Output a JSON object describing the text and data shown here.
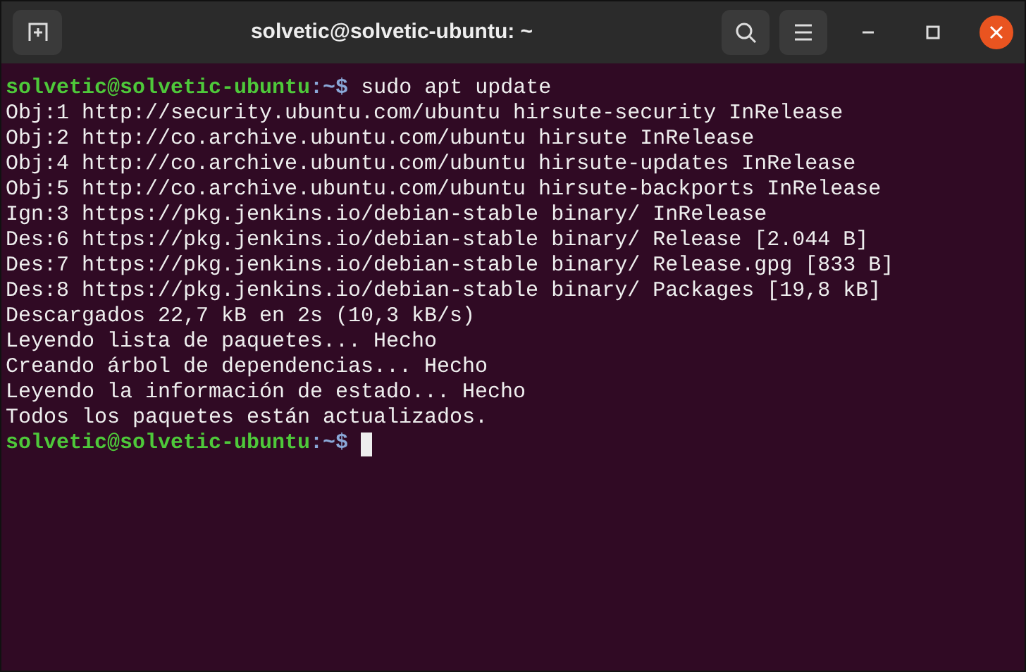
{
  "window": {
    "title": "solvetic@solvetic-ubuntu: ~"
  },
  "terminal": {
    "lines": [
      {
        "kind": "prompt",
        "user_host": "solvetic@solvetic-ubuntu",
        "path": ":~$",
        "command": "sudo apt update",
        "cursor": false
      },
      {
        "kind": "output",
        "text": "Obj:1 http://security.ubuntu.com/ubuntu hirsute-security InRelease"
      },
      {
        "kind": "output",
        "text": "Obj:2 http://co.archive.ubuntu.com/ubuntu hirsute InRelease"
      },
      {
        "kind": "output",
        "text": "Obj:4 http://co.archive.ubuntu.com/ubuntu hirsute-updates InRelease"
      },
      {
        "kind": "output",
        "text": "Obj:5 http://co.archive.ubuntu.com/ubuntu hirsute-backports InRelease"
      },
      {
        "kind": "output",
        "text": "Ign:3 https://pkg.jenkins.io/debian-stable binary/ InRelease"
      },
      {
        "kind": "output",
        "text": "Des:6 https://pkg.jenkins.io/debian-stable binary/ Release [2.044 B]"
      },
      {
        "kind": "output",
        "text": "Des:7 https://pkg.jenkins.io/debian-stable binary/ Release.gpg [833 B]"
      },
      {
        "kind": "output",
        "text": "Des:8 https://pkg.jenkins.io/debian-stable binary/ Packages [19,8 kB]"
      },
      {
        "kind": "output",
        "text": "Descargados 22,7 kB en 2s (10,3 kB/s)"
      },
      {
        "kind": "output",
        "text": "Leyendo lista de paquetes... Hecho"
      },
      {
        "kind": "output",
        "text": "Creando árbol de dependencias... Hecho"
      },
      {
        "kind": "output",
        "text": "Leyendo la información de estado... Hecho"
      },
      {
        "kind": "output",
        "text": "Todos los paquetes están actualizados."
      },
      {
        "kind": "prompt",
        "user_host": "solvetic@solvetic-ubuntu",
        "path": ":~$",
        "cursor": true
      }
    ]
  }
}
